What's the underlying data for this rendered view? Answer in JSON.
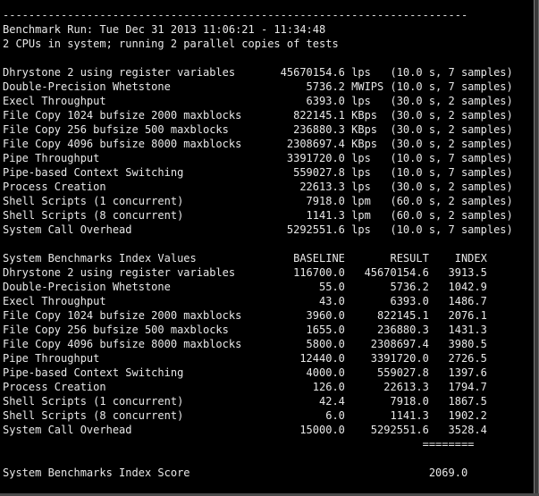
{
  "colors": {
    "background": "#000000",
    "text": "#e8e8e8"
  },
  "terminal": {
    "separator": "------------------------------------------------------------------------",
    "benchmark_run": "Benchmark Run: Tue Dec 31 2013 11:06:21 - 11:34:48",
    "cpu_info": "2 CPUs in system; running 2 parallel copies of tests",
    "results": [
      "Dhrystone 2 using register variables       45670154.6 lps   (10.0 s, 7 samples)",
      "Double-Precision Whetstone                     5736.2 MWIPS (10.0 s, 7 samples)",
      "Execl Throughput                               6393.0 lps   (30.0 s, 2 samples)",
      "File Copy 1024 bufsize 2000 maxblocks        822145.1 KBps  (30.0 s, 2 samples)",
      "File Copy 256 bufsize 500 maxblocks          236880.3 KBps  (30.0 s, 2 samples)",
      "File Copy 4096 bufsize 8000 maxblocks       2308697.4 KBps  (30.0 s, 2 samples)",
      "Pipe Throughput                             3391720.0 lps   (10.0 s, 7 samples)",
      "Pipe-based Context Switching                 559027.8 lps   (10.0 s, 7 samples)",
      "Process Creation                              22613.3 lps   (30.0 s, 2 samples)",
      "Shell Scripts (1 concurrent)                   7918.0 lpm   (60.0 s, 2 samples)",
      "Shell Scripts (8 concurrent)                   1141.3 lpm   (60.0 s, 2 samples)",
      "System Call Overhead                        5292551.6 lps   (10.0 s, 7 samples)"
    ],
    "index_header": "System Benchmarks Index Values               BASELINE       RESULT    INDEX",
    "index_rows": [
      "Dhrystone 2 using register variables         116700.0   45670154.6   3913.5",
      "Double-Precision Whetstone                       55.0       5736.2   1042.9",
      "Execl Throughput                                 43.0       6393.0   1486.7",
      "File Copy 1024 bufsize 2000 maxblocks          3960.0     822145.1   2076.1",
      "File Copy 256 bufsize 500 maxblocks            1655.0     236880.3   1431.3",
      "File Copy 4096 bufsize 8000 maxblocks          5800.0    2308697.4   3980.5",
      "Pipe Throughput                               12440.0    3391720.0   2726.5",
      "Pipe-based Context Switching                   4000.0     559027.8   1397.6",
      "Process Creation                                126.0      22613.3   1794.7",
      "Shell Scripts (1 concurrent)                     42.4       7918.0   1867.5",
      "Shell Scripts (8 concurrent)                      6.0       1141.3   1902.2",
      "System Call Overhead                          15000.0    5292551.6   3528.4"
    ],
    "score_rule": "                                                                 ========",
    "score_line": "System Benchmarks Index Score                                     2069.0"
  }
}
